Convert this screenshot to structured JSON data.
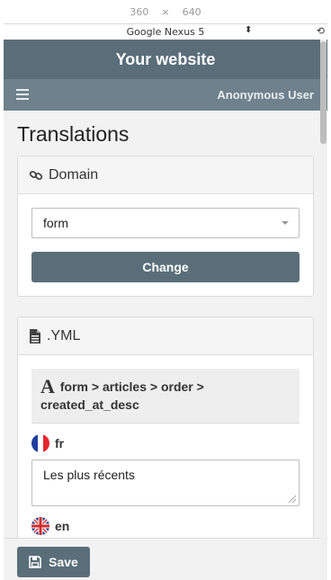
{
  "devtools": {
    "width": "360",
    "times": "×",
    "height": "640",
    "device_name": "Google Nexus 5",
    "device_dropdown_glyph": "⬍",
    "rotate_glyph": "⟲"
  },
  "header": {
    "site_title": "Your website",
    "menu_icon": "hamburger-icon",
    "user_label": "Anonymous User"
  },
  "page": {
    "title": "Translations"
  },
  "domain_panel": {
    "icon": "link-icon",
    "title": "Domain",
    "select_value": "form",
    "change_label": "Change"
  },
  "yml_panel": {
    "icon": "file-icon",
    "title": ".YML",
    "key_icon_glyph": "A",
    "key_path": "form > articles > order > created_at_desc",
    "translations": [
      {
        "lang": "fr",
        "value": "Les plus récents"
      },
      {
        "lang": "en",
        "value": ""
      }
    ]
  },
  "footer": {
    "save_label": "Save",
    "save_icon": "floppy-disk-icon"
  },
  "colors": {
    "brand": "#5a6e7a",
    "navbar": "#6e818c",
    "background": "#f2f2f2"
  }
}
